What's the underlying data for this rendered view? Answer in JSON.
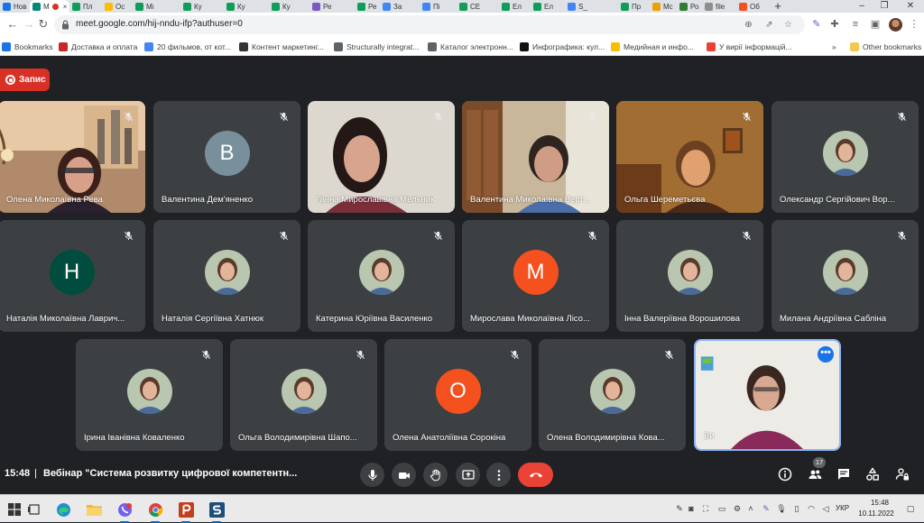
{
  "browser": {
    "tabs": [
      {
        "label": "Нов",
        "color": "#1a73e8"
      },
      {
        "label": "М",
        "color": "#00897b",
        "active": true,
        "close": "×"
      },
      {
        "label": "Пл",
        "color": "#0f9d58"
      },
      {
        "label": "Ос",
        "color": "#fbbc04"
      },
      {
        "label": "Мі",
        "color": "#0f9d58"
      },
      {
        "label": "Ку",
        "color": "#0f9d58"
      },
      {
        "label": "Ку",
        "color": "#0f9d58"
      },
      {
        "label": "Ку",
        "color": "#0f9d58"
      },
      {
        "label": "Ре",
        "color": "#7e57c2"
      },
      {
        "label": "Ре",
        "color": "#0f9d58"
      },
      {
        "label": "За",
        "color": "#4285f4"
      },
      {
        "label": "Пі",
        "color": "#4285f4"
      },
      {
        "label": "СЕ",
        "color": "#0f9d58"
      },
      {
        "label": "Ел",
        "color": "#0f9d58"
      },
      {
        "label": "Ел",
        "color": "#0f9d58"
      },
      {
        "label": "S_",
        "color": "#4285f4"
      },
      {
        "label": "Пр",
        "color": "#0f9d58"
      },
      {
        "label": "Mc",
        "color": "#e8a100"
      },
      {
        "label": "Ро",
        "color": "#2e7d32"
      },
      {
        "label": "file",
        "color": "#8e8e8e"
      },
      {
        "label": "Об",
        "color": "#f4511e"
      }
    ],
    "new_tab": "+",
    "window_controls": {
      "minimize": "–",
      "restore": "❐",
      "close": "✕"
    },
    "url": "meet.google.com/hij-nndu-ifp?authuser=0",
    "bookmarks": [
      {
        "label": "Bookmarks",
        "color": "#1a73e8"
      },
      {
        "label": "Доставка и оплата",
        "color": "#c62828"
      },
      {
        "label": "20 фильмов, от кот...",
        "color": "#4285f4"
      },
      {
        "label": "Контент маркетинг...",
        "color": "#333333"
      },
      {
        "label": "Structurally integrat...",
        "color": "#5f6368"
      },
      {
        "label": "Каталог электронн...",
        "color": "#5f6368"
      },
      {
        "label": "Инфографика: кул...",
        "color": "#111111"
      },
      {
        "label": "Медийная и инфо...",
        "color": "#fbbc04"
      },
      {
        "label": "У вирії інформацій...",
        "color": "#ea4335"
      }
    ],
    "bookmarks_more": "»",
    "other_bookmarks": "Other bookmarks"
  },
  "meet": {
    "recording_label": "Запис",
    "participants": [
      {
        "name": "Олена Миколаївна Рева",
        "kind": "video",
        "scene": "room"
      },
      {
        "name": "Валентина Дем'яненко",
        "kind": "initial",
        "initial": "B",
        "color": "#78909c"
      },
      {
        "name": "Ганна Мирославівна Мельник",
        "kind": "video",
        "scene": "wall"
      },
      {
        "name": "Валентина Миколаївна Верт...",
        "kind": "video",
        "scene": "wardrobe"
      },
      {
        "name": "Ольга Шереметьєва",
        "kind": "video",
        "scene": "warm"
      },
      {
        "name": "Олександр Сергійович Вор...",
        "kind": "photo"
      },
      {
        "name": "Наталія Миколаївна Лаврич...",
        "kind": "initial",
        "initial": "H",
        "color": "#004d40"
      },
      {
        "name": "Наталія Сергіївна Хатнюк",
        "kind": "photo"
      },
      {
        "name": "Катерина Юріївна Василенко",
        "kind": "photo"
      },
      {
        "name": "Мирослава Миколаївна Лісо...",
        "kind": "initial",
        "initial": "M",
        "color": "#f4511e"
      },
      {
        "name": "Інна Валеріївна Ворошилова",
        "kind": "photo"
      },
      {
        "name": "Милана Андріївна Сабліна",
        "kind": "photo"
      },
      {
        "name": "Ірина Іванівна Коваленко",
        "kind": "photo"
      },
      {
        "name": "Ольга Володимирівна Шапо...",
        "kind": "photo"
      },
      {
        "name": "Олена Анатоліївна Сорокіна",
        "kind": "initial",
        "initial": "O",
        "color": "#f4511e"
      },
      {
        "name": "Олена Володимирівна Кова...",
        "kind": "photo"
      },
      {
        "name": "Ви",
        "kind": "self"
      }
    ],
    "self_more": "•••",
    "time": "15:48",
    "separator": "|",
    "meeting_title": "Вебінар \"Система розвитку цифрової компетентн...",
    "people_count": "17"
  },
  "taskbar": {
    "language": "УКР",
    "time": "15:48",
    "date": "10.11.2022"
  }
}
